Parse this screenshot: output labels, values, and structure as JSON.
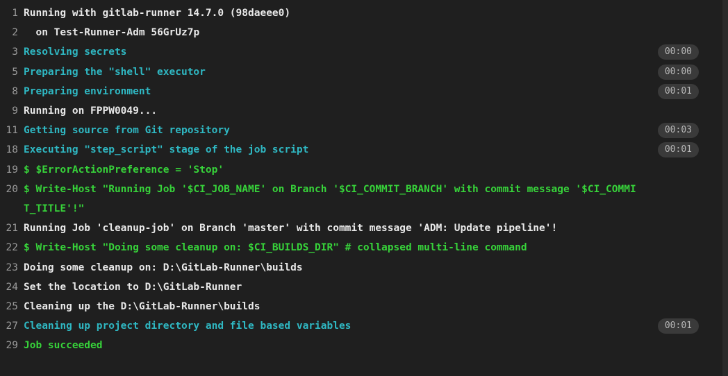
{
  "lines": [
    {
      "no": "1",
      "text": "Running with gitlab-runner 14.7.0 (98daeee0)",
      "color": "white"
    },
    {
      "no": "2",
      "text": "  on Test-Runner-Adm 56GrUz7p",
      "color": "white"
    },
    {
      "no": "3",
      "text": "Resolving secrets",
      "color": "cyan",
      "duration": "00:00"
    },
    {
      "no": "5",
      "text": "Preparing the \"shell\" executor",
      "color": "cyan",
      "duration": "00:00"
    },
    {
      "no": "8",
      "text": "Preparing environment",
      "color": "cyan",
      "duration": "00:01"
    },
    {
      "no": "9",
      "text": "Running on FPPW0049...",
      "color": "white"
    },
    {
      "no": "11",
      "text": "Getting source from Git repository",
      "color": "cyan",
      "duration": "00:03"
    },
    {
      "no": "18",
      "text": "Executing \"step_script\" stage of the job script",
      "color": "cyan",
      "duration": "00:01"
    },
    {
      "no": "19",
      "text": "$ $ErrorActionPreference = 'Stop'",
      "color": "green"
    },
    {
      "no": "20",
      "text": "$ Write-Host \"Running Job '$CI_JOB_NAME' on Branch '$CI_COMMIT_BRANCH' with commit message '$CI_COMMIT_TITLE'!\"",
      "color": "green"
    },
    {
      "no": "21",
      "text": "Running Job 'cleanup-job' on Branch 'master' with commit message 'ADM: Update pipeline'!",
      "color": "white"
    },
    {
      "no": "22",
      "text": "$ Write-Host \"Doing some cleanup on: $CI_BUILDS_DIR\" # collapsed multi-line command",
      "color": "green"
    },
    {
      "no": "23",
      "text": "Doing some cleanup on: D:\\GitLab-Runner\\builds",
      "color": "white"
    },
    {
      "no": "24",
      "text": "Set the location to D:\\GitLab-Runner",
      "color": "white"
    },
    {
      "no": "25",
      "text": "Cleaning up the D:\\GitLab-Runner\\builds",
      "color": "white"
    },
    {
      "no": "27",
      "text": "Cleaning up project directory and file based variables",
      "color": "cyan",
      "duration": "00:01"
    },
    {
      "no": "29",
      "text": "Job succeeded",
      "color": "green"
    }
  ],
  "colors": {
    "background": "#1f1f1f",
    "white": "#e8e8e8",
    "cyan": "#2fb8c3",
    "green": "#37d33a",
    "lineno": "#9a9a9a",
    "badge_bg": "#3a3a3a",
    "badge_text": "#b8b8b8"
  }
}
